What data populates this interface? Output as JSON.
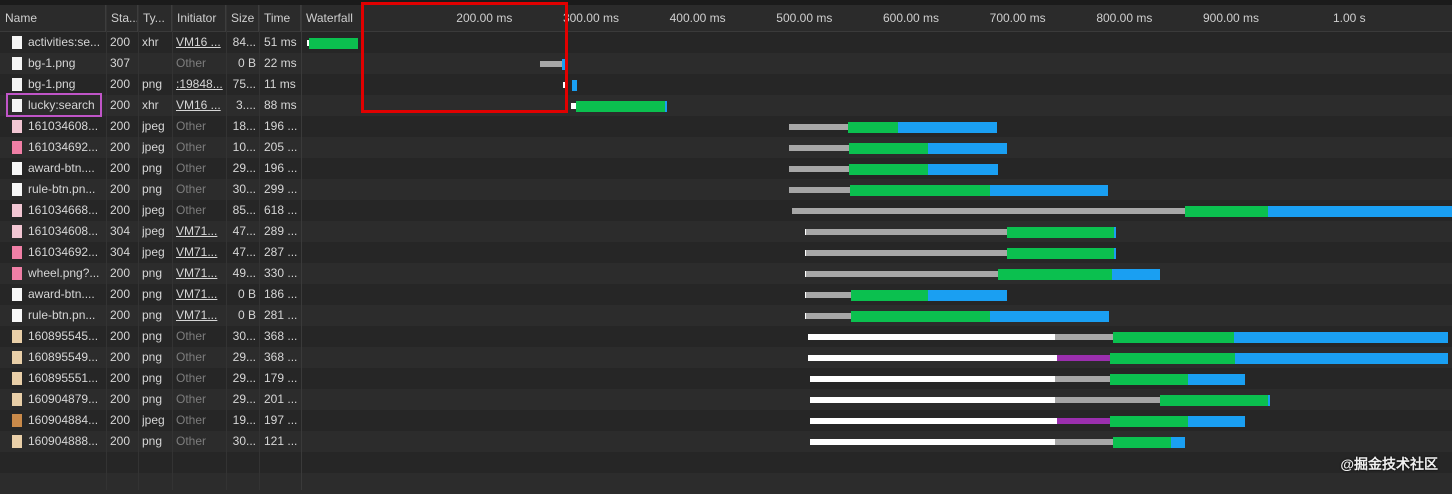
{
  "columns": {
    "name": "Name",
    "status": "Sta...",
    "type": "Ty...",
    "initiator": "Initiator",
    "size": "Size",
    "time": "Time",
    "waterfall": "Waterfall"
  },
  "timeline_ticks": [
    "200.00 ms",
    "300.00 ms",
    "400.00 ms",
    "500.00 ms",
    "600.00 ms",
    "700.00 ms",
    "800.00 ms",
    "900.00 ms",
    "1.00 s"
  ],
  "colors": {
    "queue": "#ffffff",
    "stalled": "#a7a7a7",
    "proxy": "#9b2fae",
    "waiting": "#0bc04f",
    "download": "#1a9ff2",
    "highlight_red": "#e10000",
    "highlight_pink": "#c055c8"
  },
  "watermark": "@掘金技术社区",
  "requests": [
    {
      "name": "activities:se...",
      "status": "200",
      "type": "xhr",
      "initiator": "VM16 ...",
      "initiator_kind": "link",
      "size": "84...",
      "time": "51 ms",
      "icon": "document",
      "timing": [
        [
          4,
          6,
          "q"
        ],
        [
          6,
          52,
          "g"
        ]
      ]
    },
    {
      "name": "bg-1.png",
      "status": "307",
      "type": "",
      "initiator": "Other",
      "initiator_kind": "other",
      "size": "0 B",
      "time": "22 ms",
      "icon": "document",
      "timing": [
        [
          222,
          243,
          "w"
        ],
        [
          243,
          246,
          "b"
        ]
      ]
    },
    {
      "name": "bg-1.png",
      "status": "200",
      "type": "png",
      "initiator": ":19848...",
      "initiator_kind": "link",
      "size": "75...",
      "time": "11 ms",
      "icon": "document",
      "timing": [
        [
          244,
          248,
          "q"
        ],
        [
          252,
          257,
          "b"
        ]
      ]
    },
    {
      "name": "lucky:search",
      "status": "200",
      "type": "xhr",
      "initiator": "VM16 ...",
      "initiator_kind": "link",
      "size": "3....",
      "time": "88 ms",
      "icon": "document",
      "timing": [
        [
          251,
          256,
          "q"
        ],
        [
          256,
          339,
          "g"
        ],
        [
          339,
          341,
          "b"
        ]
      ]
    },
    {
      "name": "161034608...",
      "status": "200",
      "type": "jpeg",
      "initiator": "Other",
      "initiator_kind": "other",
      "size": "18...",
      "time": "196 ...",
      "icon": "image-pink",
      "timing": [
        [
          456,
          511,
          "w"
        ],
        [
          511,
          558,
          "g"
        ],
        [
          558,
          651,
          "b"
        ]
      ]
    },
    {
      "name": "161034692...",
      "status": "200",
      "type": "jpeg",
      "initiator": "Other",
      "initiator_kind": "other",
      "size": "10...",
      "time": "205 ...",
      "icon": "image-flower",
      "timing": [
        [
          456,
          512,
          "w"
        ],
        [
          512,
          586,
          "g"
        ],
        [
          586,
          660,
          "b"
        ]
      ]
    },
    {
      "name": "award-btn....",
      "status": "200",
      "type": "png",
      "initiator": "Other",
      "initiator_kind": "other",
      "size": "29...",
      "time": "196 ...",
      "icon": "image-white",
      "timing": [
        [
          456,
          512,
          "w"
        ],
        [
          512,
          586,
          "g"
        ],
        [
          586,
          652,
          "b"
        ]
      ]
    },
    {
      "name": "rule-btn.pn...",
      "status": "200",
      "type": "png",
      "initiator": "Other",
      "initiator_kind": "other",
      "size": "30...",
      "time": "299 ...",
      "icon": "image-white",
      "timing": [
        [
          456,
          513,
          "w"
        ],
        [
          513,
          644,
          "g"
        ],
        [
          644,
          755,
          "b"
        ]
      ]
    },
    {
      "name": "161034668...",
      "status": "200",
      "type": "jpeg",
      "initiator": "Other",
      "initiator_kind": "other",
      "size": "85...",
      "time": "618 ...",
      "icon": "image-pink",
      "timing": [
        [
          458,
          827,
          "w"
        ],
        [
          827,
          905,
          "g"
        ],
        [
          905,
          1077,
          "b"
        ]
      ]
    },
    {
      "name": "161034608...",
      "status": "304",
      "type": "jpeg",
      "initiator": "VM71...",
      "initiator_kind": "link",
      "size": "47...",
      "time": "289 ...",
      "icon": "image-pink",
      "timing": [
        [
          471,
          472,
          "q"
        ],
        [
          472,
          660,
          "w"
        ],
        [
          660,
          760,
          "g"
        ],
        [
          760,
          762,
          "b"
        ]
      ]
    },
    {
      "name": "161034692...",
      "status": "304",
      "type": "jpeg",
      "initiator": "VM71...",
      "initiator_kind": "link",
      "size": "47...",
      "time": "287 ...",
      "icon": "image-flower",
      "timing": [
        [
          471,
          472,
          "q"
        ],
        [
          472,
          660,
          "w"
        ],
        [
          660,
          760,
          "g"
        ],
        [
          760,
          762,
          "b"
        ]
      ]
    },
    {
      "name": "wheel.png?...",
      "status": "200",
      "type": "png",
      "initiator": "VM71...",
      "initiator_kind": "link",
      "size": "49...",
      "time": "330 ...",
      "icon": "image-flower",
      "timing": [
        [
          471,
          472,
          "q"
        ],
        [
          472,
          652,
          "w"
        ],
        [
          652,
          758,
          "g"
        ],
        [
          758,
          803,
          "b"
        ]
      ]
    },
    {
      "name": "award-btn....",
      "status": "200",
      "type": "png",
      "initiator": "VM71...",
      "initiator_kind": "link",
      "size": "0 B",
      "time": "186 ...",
      "icon": "image-white",
      "timing": [
        [
          471,
          472,
          "q"
        ],
        [
          472,
          514,
          "w"
        ],
        [
          514,
          586,
          "g"
        ],
        [
          586,
          660,
          "b"
        ]
      ]
    },
    {
      "name": "rule-btn.pn...",
      "status": "200",
      "type": "png",
      "initiator": "VM71...",
      "initiator_kind": "link",
      "size": "0 B",
      "time": "281 ...",
      "icon": "image-white",
      "timing": [
        [
          471,
          472,
          "q"
        ],
        [
          472,
          514,
          "w"
        ],
        [
          514,
          644,
          "g"
        ],
        [
          644,
          756,
          "b"
        ]
      ]
    },
    {
      "name": "160895545...",
      "status": "200",
      "type": "png",
      "initiator": "Other",
      "initiator_kind": "other",
      "size": "30...",
      "time": "368 ...",
      "icon": "image-tan",
      "timing": [
        [
          473,
          705,
          "q"
        ],
        [
          705,
          759,
          "w"
        ],
        [
          759,
          873,
          "g"
        ],
        [
          873,
          1073,
          "b"
        ]
      ]
    },
    {
      "name": "160895549...",
      "status": "200",
      "type": "png",
      "initiator": "Other",
      "initiator_kind": "other",
      "size": "29...",
      "time": "368 ...",
      "icon": "image-tan",
      "timing": [
        [
          473,
          707,
          "q"
        ],
        [
          707,
          757,
          "p"
        ],
        [
          757,
          874,
          "g"
        ],
        [
          874,
          1073,
          "b"
        ]
      ]
    },
    {
      "name": "160895551...",
      "status": "200",
      "type": "png",
      "initiator": "Other",
      "initiator_kind": "other",
      "size": "29...",
      "time": "179 ...",
      "icon": "image-tan",
      "timing": [
        [
          475,
          705,
          "q"
        ],
        [
          705,
          757,
          "w"
        ],
        [
          757,
          830,
          "g"
        ],
        [
          830,
          883,
          "b"
        ]
      ]
    },
    {
      "name": "160904879...",
      "status": "200",
      "type": "png",
      "initiator": "Other",
      "initiator_kind": "other",
      "size": "29...",
      "time": "201 ...",
      "icon": "image-tan",
      "timing": [
        [
          475,
          705,
          "q"
        ],
        [
          705,
          803,
          "w"
        ],
        [
          803,
          905,
          "g"
        ],
        [
          905,
          907,
          "b"
        ]
      ]
    },
    {
      "name": "160904884...",
      "status": "200",
      "type": "jpeg",
      "initiator": "Other",
      "initiator_kind": "other",
      "size": "19...",
      "time": "197 ...",
      "icon": "image-brown",
      "timing": [
        [
          475,
          707,
          "q"
        ],
        [
          707,
          757,
          "p"
        ],
        [
          757,
          830,
          "g"
        ],
        [
          830,
          883,
          "b"
        ]
      ]
    },
    {
      "name": "160904888...",
      "status": "200",
      "type": "png",
      "initiator": "Other",
      "initiator_kind": "other",
      "size": "30...",
      "time": "121 ...",
      "icon": "image-tan",
      "timing": [
        [
          475,
          705,
          "q"
        ],
        [
          705,
          759,
          "w"
        ],
        [
          759,
          814,
          "g"
        ],
        [
          814,
          827,
          "b"
        ]
      ]
    }
  ]
}
